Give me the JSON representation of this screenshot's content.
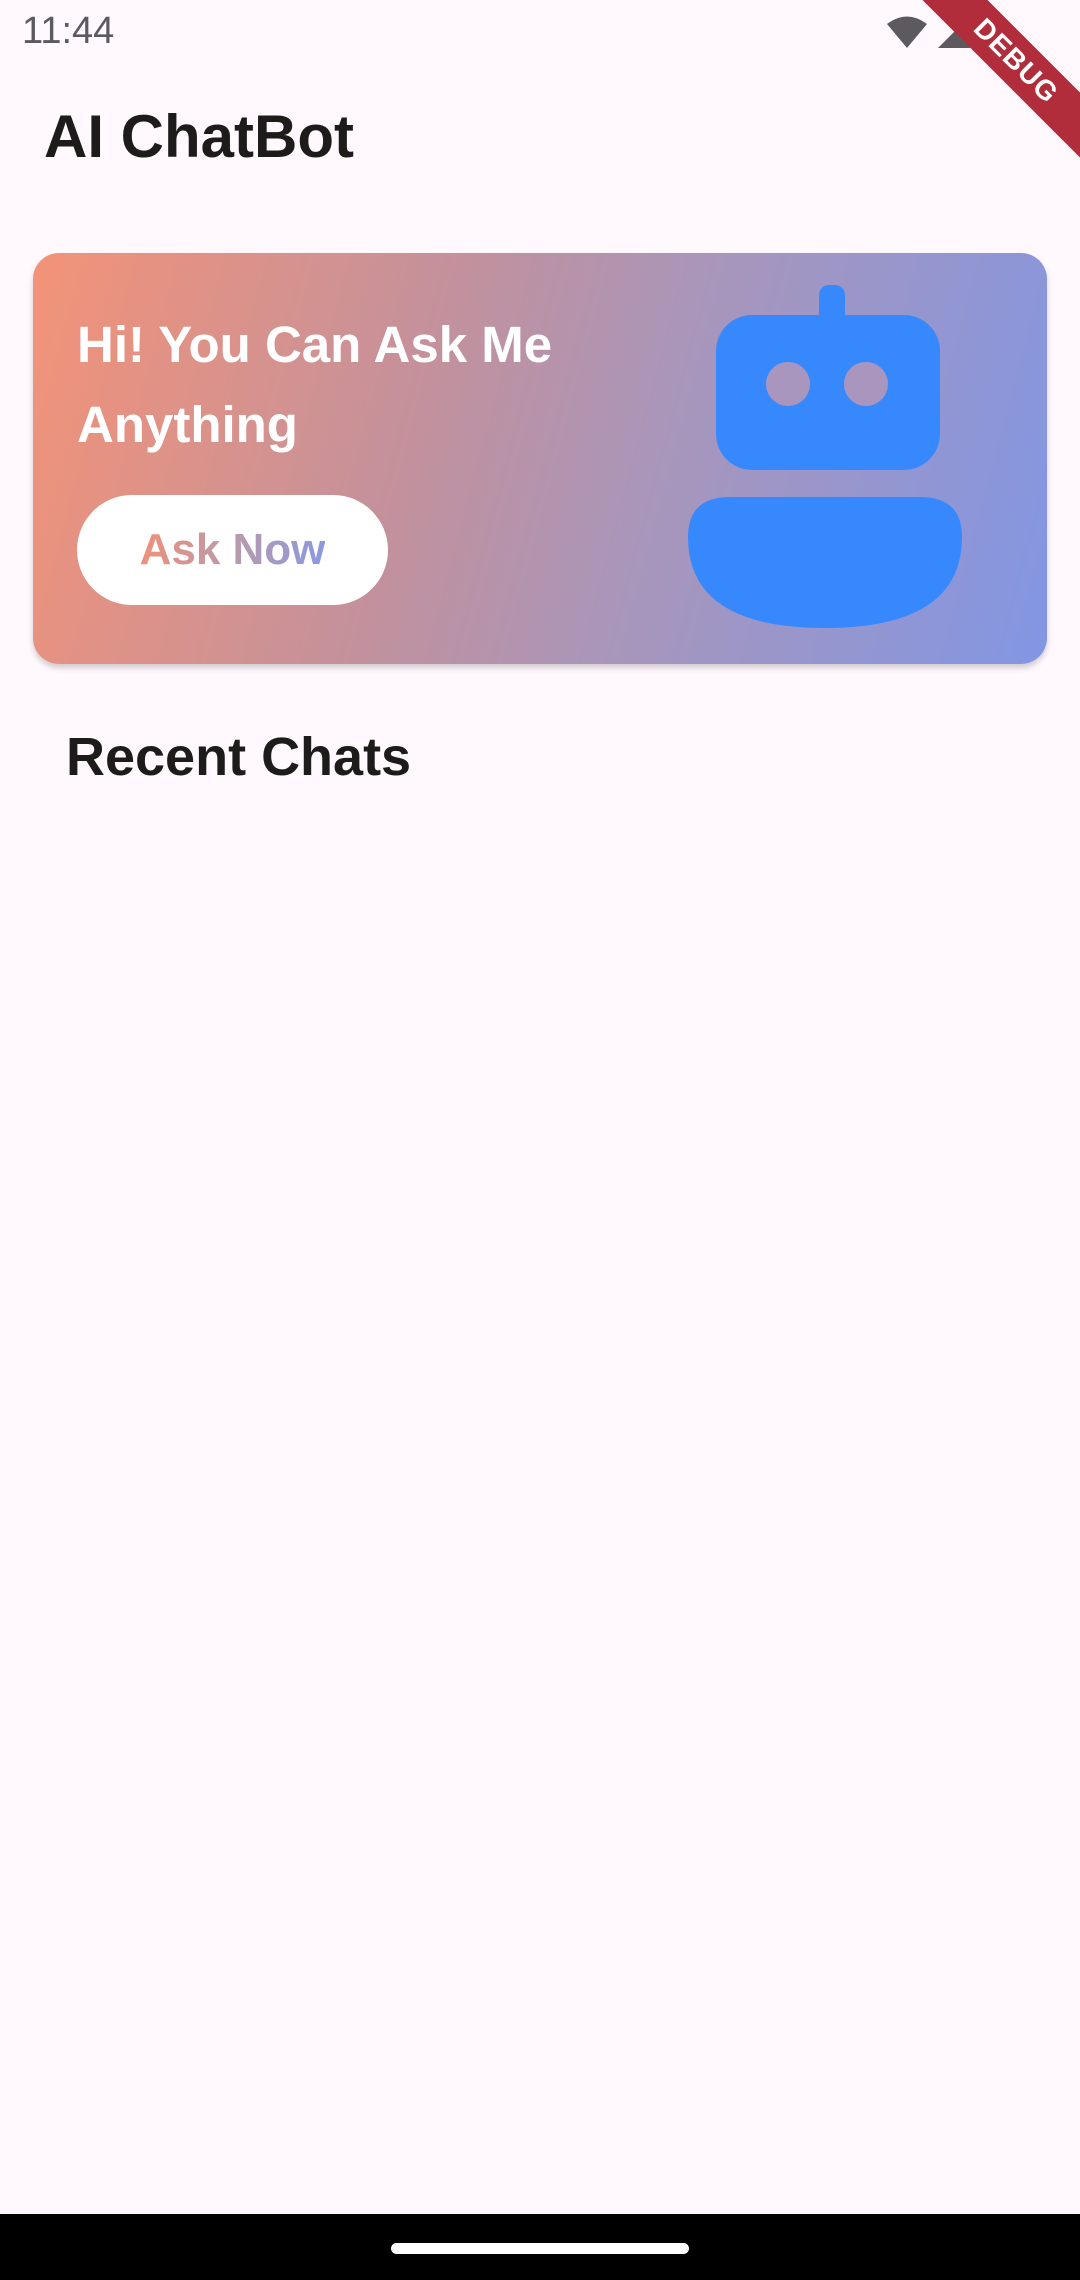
{
  "status_bar": {
    "time": "11:44",
    "icons": [
      "wifi-icon",
      "signal-icon",
      "battery-icon"
    ]
  },
  "debug_banner": {
    "label": "DEBUG",
    "color": "#b22d3c"
  },
  "app_bar": {
    "title": "AI ChatBot"
  },
  "hero": {
    "headline": "Hi! You Can Ask Me Anything",
    "button_label": "Ask Now",
    "icon": "robot-icon",
    "gradient": [
      "#f39378",
      "#8296e3"
    ],
    "icon_color": "#3888fd"
  },
  "recent": {
    "title": "Recent Chats",
    "items": []
  },
  "colors": {
    "background": "#fff8fd",
    "text": "#1e1b1b"
  }
}
